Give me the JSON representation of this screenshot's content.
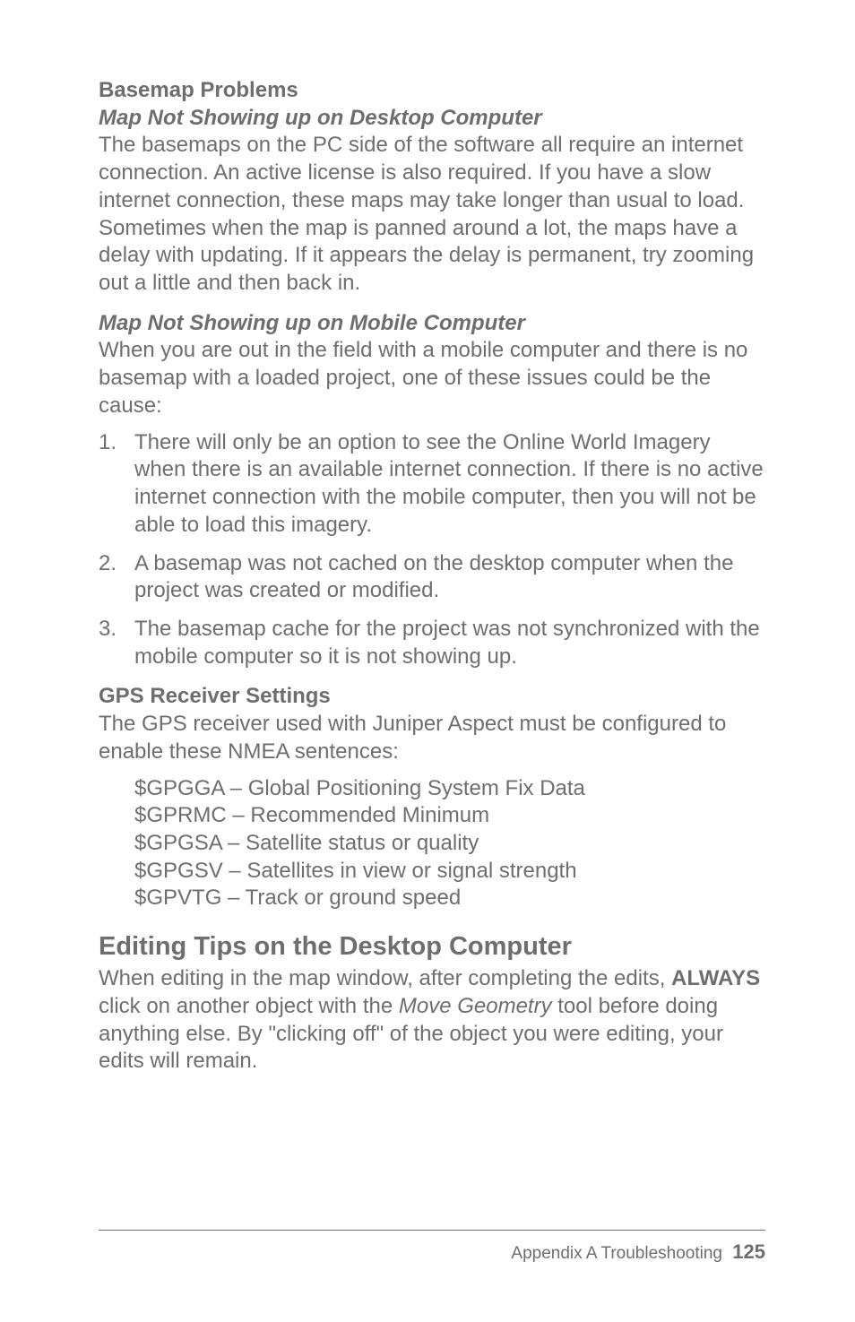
{
  "sections": {
    "basemap": {
      "heading": "Basemap Problems",
      "sub1_heading": "Map Not Showing up on Desktop Computer",
      "sub1_body": "The basemaps on the PC side of the software all require an internet connection. An active license is also required. If you have a slow internet connection, these maps may take longer than usual to load. Sometimes when the map is panned around a lot, the maps have a delay with updating. If it appears the delay is permanent, try zooming out a little and then back in.",
      "sub2_heading": "Map Not Showing up on Mobile Computer",
      "sub2_body": "When you are out in the field with a mobile computer and there is no basemap with a loaded project, one of these issues could be the cause:",
      "list": {
        "n1": "1.",
        "i1": "There will only be an option to see the Online World Imagery when there is an available internet connection. If there is no active internet connection with the mobile computer, then you will not be able to load this imagery.",
        "n2": "2.",
        "i2": "A basemap was not cached on the desktop computer when the project was created or modified.",
        "n3": "3.",
        "i3": "The basemap cache for the project was not synchronized with the mobile computer so it is not showing up."
      }
    },
    "gps": {
      "heading": "GPS Receiver Settings",
      "body": "The GPS receiver used with Juniper Aspect must be configured to enable these NMEA sentences:",
      "nmea": {
        "l1": "$GPGGA – Global Positioning System Fix Data",
        "l2": "$GPRMC – Recommended Minimum",
        "l3": "$GPGSA – Satellite status or quality",
        "l4": "$GPGSV – Satellites in view or signal strength",
        "l5": "$GPVTG – Track or ground speed"
      }
    },
    "editing": {
      "heading": "Editing Tips on the Desktop Computer",
      "body_pre": "When editing in the map window, after completing the edits, ",
      "body_strong": "ALWAYS",
      "body_mid": " click on another object with the ",
      "body_italic": "Move Geometry",
      "body_post": " tool before doing anything else. By \"clicking off\" of the object you were editing, your edits will remain."
    }
  },
  "footer": {
    "label": "Appendix A   Troubleshooting",
    "page": "125"
  }
}
